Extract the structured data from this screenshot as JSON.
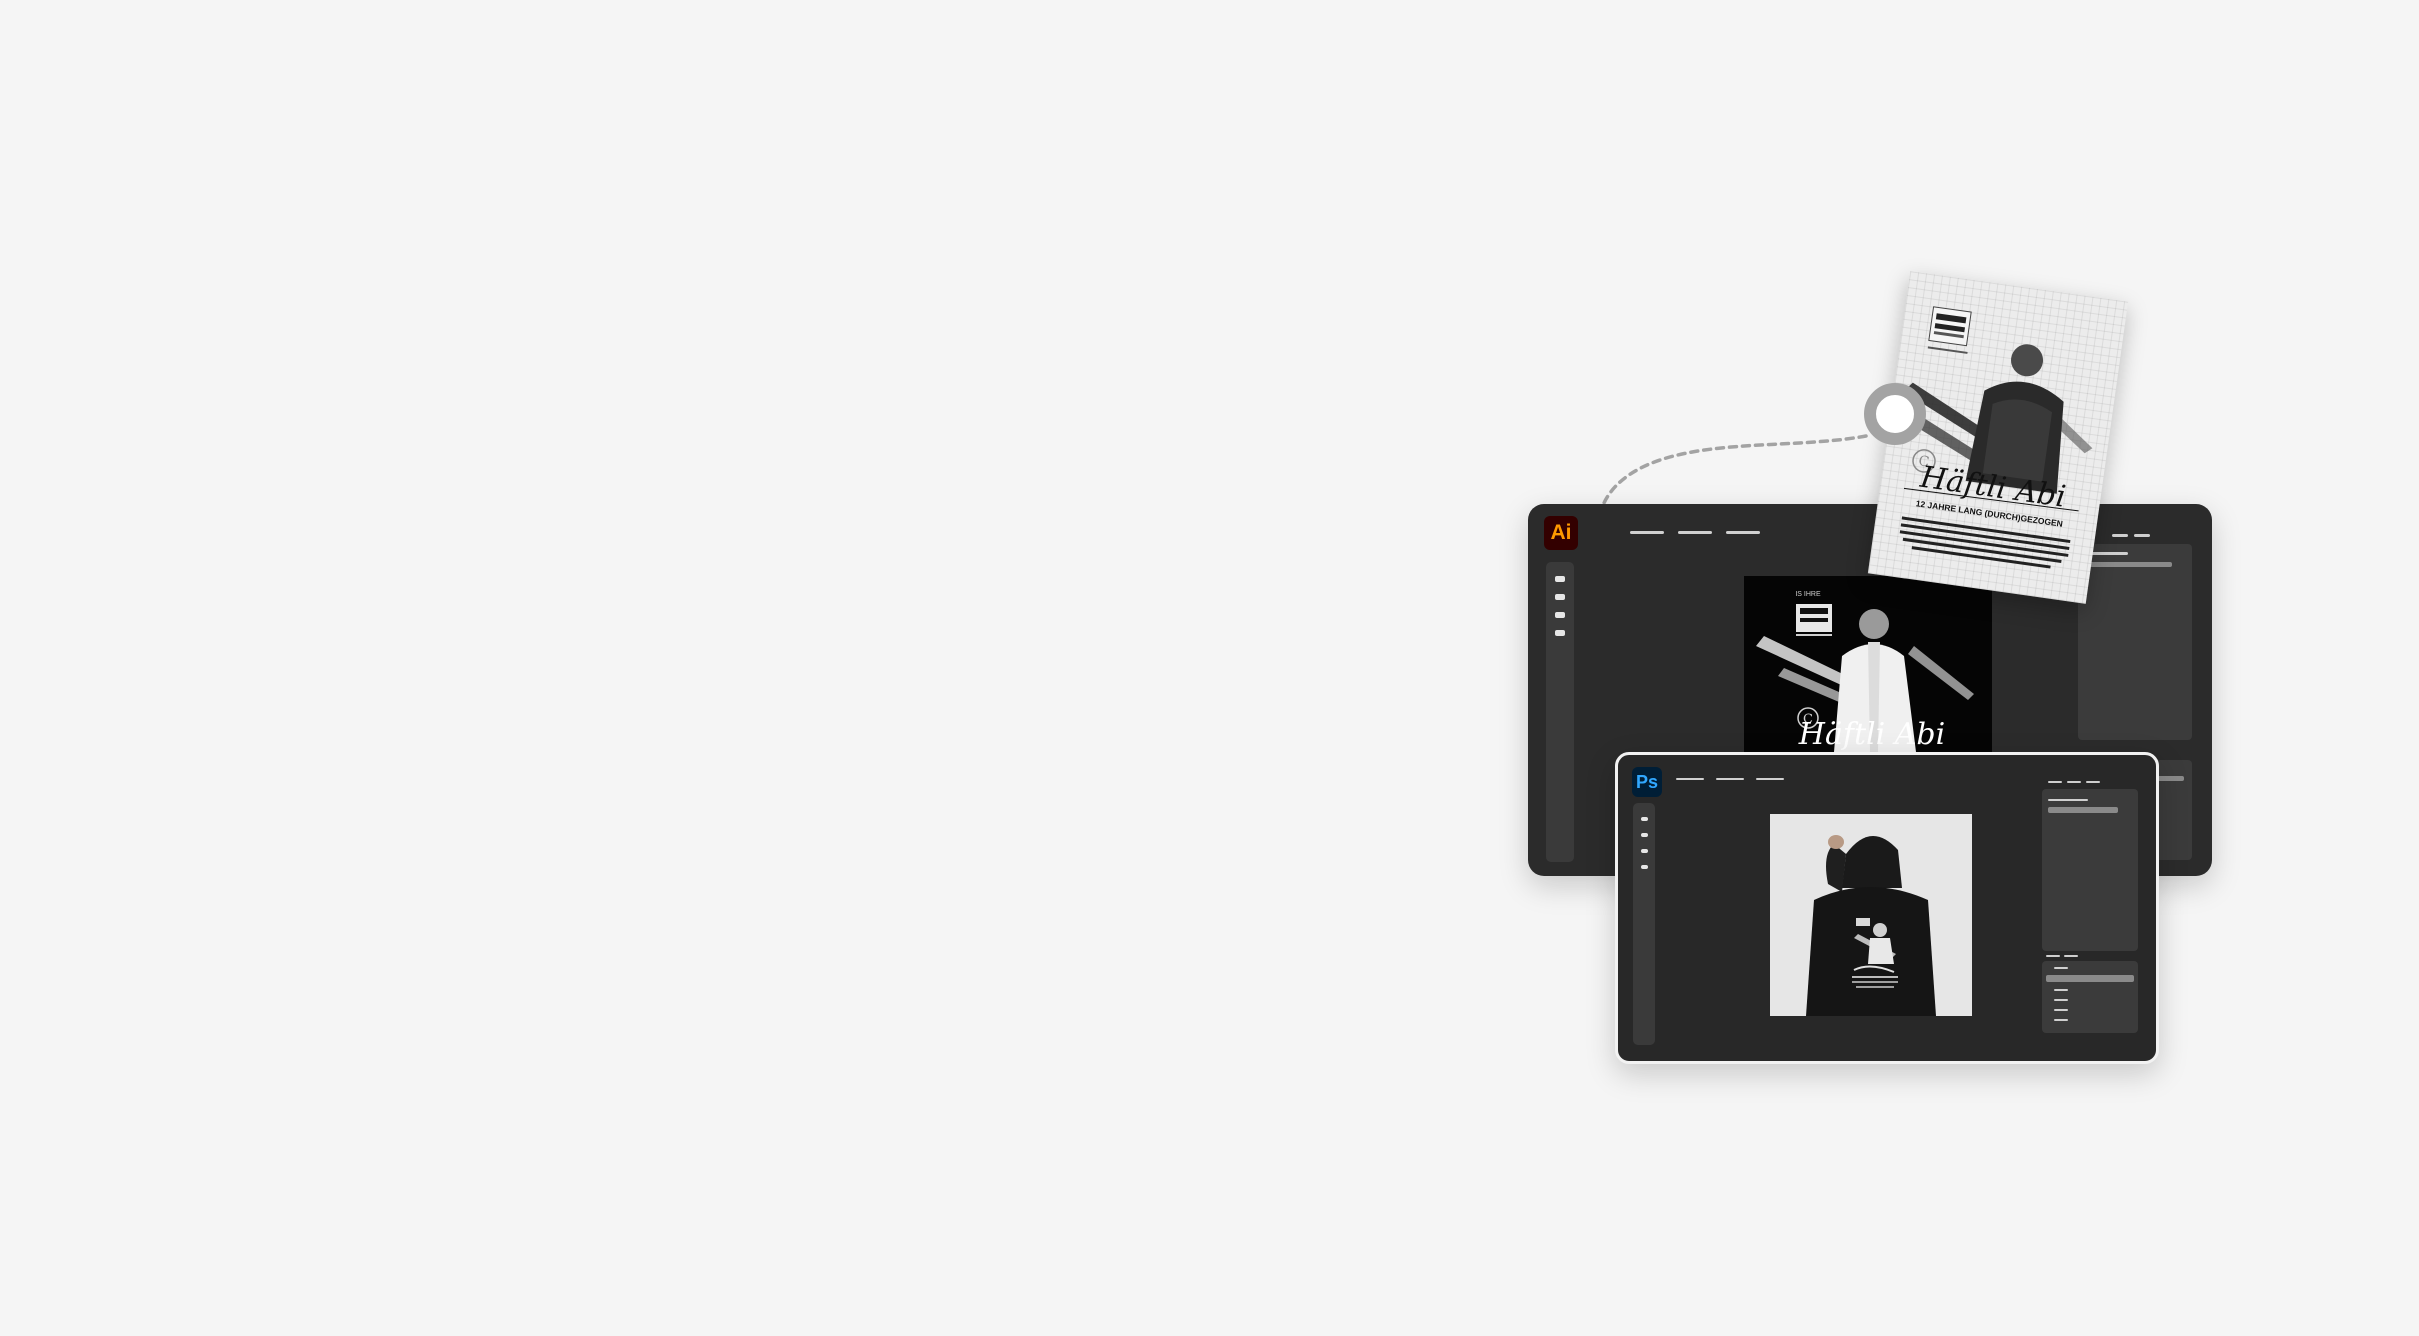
{
  "illustrator": {
    "badge": "Ai",
    "canvas_artwork": {
      "title": "Häftli Abi",
      "badge_letter": "C",
      "mini_text": "IS IHRE"
    }
  },
  "photoshop": {
    "badge": "Ps"
  },
  "poster": {
    "title": "Häftli Abi",
    "subtitle": "12 JAHRE LANG (DURCH)GEZOGEN",
    "badge_letter": "C"
  },
  "colors": {
    "page_bg": "#f5f5f5",
    "window_bg": "#2b2b2b",
    "ai_badge_bg": "#330000",
    "ai_badge_fg": "#ff9a00",
    "ps_badge_bg": "#001e36",
    "ps_badge_fg": "#31a8ff",
    "connector": "#a3a3a3"
  }
}
